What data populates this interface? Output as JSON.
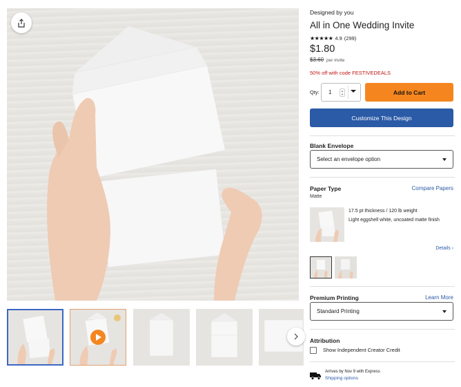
{
  "product": {
    "designed_by": "Designed by you",
    "title": "All in One Wedding Invite",
    "stars": "★★★★★",
    "rating": "4.9",
    "review_count": "(299)",
    "price": "$1.80",
    "old_price": "$3.60",
    "price_unit": "per invite",
    "discount": "50% off with code FESTIVEDEALS"
  },
  "purchase": {
    "qty_label": "Qty:",
    "qty_value": "1",
    "add_to_cart": "Add to Cart",
    "customize": "Customize This Design"
  },
  "envelope": {
    "label": "Blank Envelope",
    "selected": "Select an envelope option"
  },
  "paper": {
    "label": "Paper Type",
    "compare_link": "Compare Papers",
    "selected": "Matte",
    "thickness": "17.5 pt thickness / 120 lb weight",
    "finish": "Light eggshell white, uncoated matte finish",
    "details_link": "Details ›"
  },
  "printing": {
    "label": "Premium Printing",
    "learn_more": "Learn More",
    "selected": "Standard Printing"
  },
  "attribution": {
    "label": "Attribution",
    "checkbox_label": "Show Independent Creator Credit"
  },
  "shipping": {
    "arrival": "Arrives by Nov 9 with Express",
    "options_link": "Shipping options"
  },
  "colors": {
    "accent_orange": "#f5861f",
    "accent_blue": "#2b5aa6",
    "discount_red": "#c01414"
  },
  "icons": [
    "share-icon",
    "chevron-right-icon",
    "play-icon",
    "caret-down-icon",
    "truck-icon"
  ]
}
